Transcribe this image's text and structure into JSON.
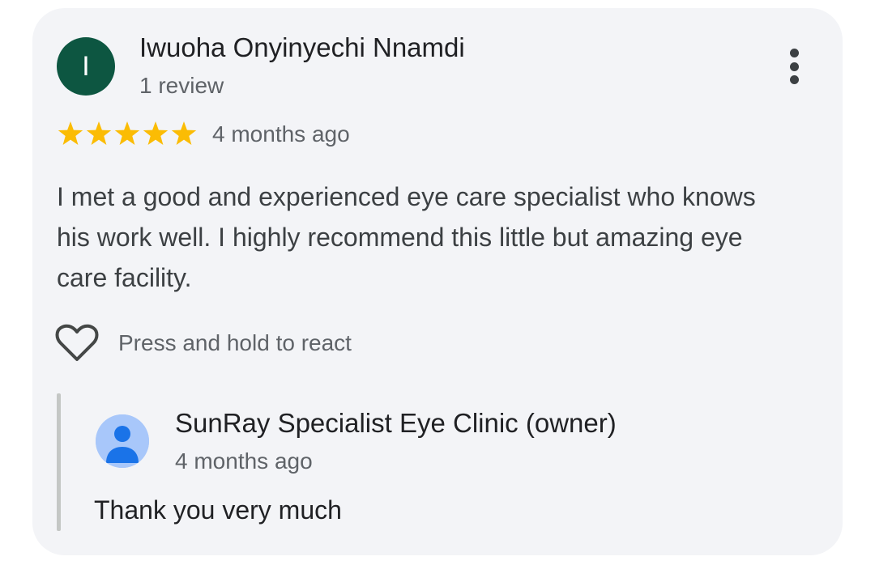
{
  "review": {
    "avatar_initial": "I",
    "reviewer_name": "Iwuoha Onyinyechi Nnamdi",
    "review_count": "1 review",
    "rating": 5,
    "rating_max": 5,
    "time_ago": "4 months ago",
    "text": "I met a good and experienced eye care specialist who knows his work well. I highly recommend this little but amazing eye care facility.",
    "react_label": "Press and hold to react"
  },
  "owner_reply": {
    "name": "SunRay Specialist Eye Clinic (owner)",
    "time_ago": "4 months ago",
    "text": "Thank you very much"
  },
  "icons": {
    "more": "more-vert-icon",
    "star": "star-icon",
    "heart": "heart-outline-icon",
    "owner_avatar": "person-icon"
  },
  "colors": {
    "card_background": "#f3f4f7",
    "avatar_background": "#0d5641",
    "star": "#fbbc04",
    "owner_avatar_background": "#a8c7fa",
    "owner_avatar_figure": "#1a73e8"
  }
}
